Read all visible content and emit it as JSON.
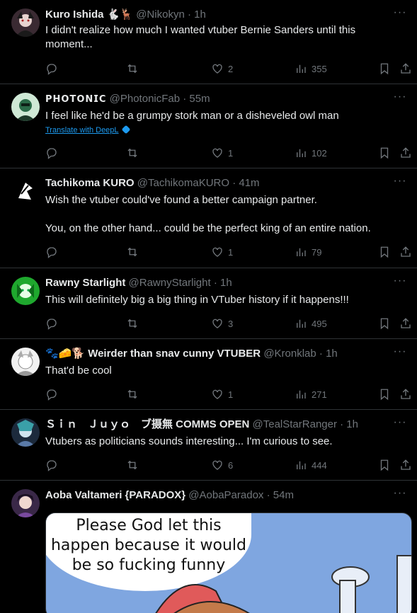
{
  "tweets": [
    {
      "name": "Kuro Ishida 🐇🦌",
      "handle": "@Nikokyn",
      "time": "· 1h",
      "text": "I didn't realize how much I wanted vtuber Bernie Sanders until this moment...",
      "replies": "",
      "retweets": "",
      "likes": "2",
      "views": "355",
      "avatar_color": "#5a3e4a"
    },
    {
      "name": "𝗣𝗛𝗢𝗧𝗢𝗡𝗜𝗖",
      "handle": "@PhotonicFab",
      "time": "· 55m",
      "text": "I feel like he'd be a grumpy stork man or a disheveled owl man",
      "translate": "Translate with DeepL",
      "replies": "",
      "retweets": "",
      "likes": "1",
      "views": "102",
      "avatar_color": "#3a8a5a"
    },
    {
      "name": "Tachikoma KURO",
      "handle": "@TachikomaKURO",
      "time": "· 41m",
      "text": "Wish the vtuber could've found a better campaign partner.\n\nYou, on the other hand... could be the perfect king of an entire nation.",
      "replies": "",
      "retweets": "",
      "likes": "1",
      "views": "79",
      "avatar_color": "#ffffff"
    },
    {
      "name": "Rawny Starlight",
      "handle": "@RawnyStarlight",
      "time": "· 1h",
      "text": "This will definitely big a big thing in VTuber history if it happens!!!",
      "replies": "",
      "retweets": "",
      "likes": "3",
      "views": "495",
      "avatar_color": "#2fbf3c"
    },
    {
      "name": "🐾🧀🐕 Weirder than snav cunny VTUBER",
      "handle": "@Kronklab",
      "time": "· 1h",
      "text": "That'd be cool",
      "replies": "",
      "retweets": "",
      "likes": "1",
      "views": "271",
      "avatar_color": "#d9d9d9"
    },
    {
      "name": "Ｓｉｎ　Ｊｕｙｏ　ブ摄無 COMMS OPEN",
      "handle": "@TealStarRanger",
      "time": "· 1h",
      "text": "Vtubers as politicians sounds interesting... I'm curious to see.",
      "replies": "",
      "retweets": "",
      "likes": "6",
      "views": "444",
      "avatar_color": "#3c5a7a"
    },
    {
      "name": "Aoba Valtameri {PARADOX}",
      "handle": "@AobaParadox",
      "time": "· 54m",
      "media_text": "Please God let this happen because it would be so fucking funny",
      "avatar_color": "#6a4a7a"
    }
  ]
}
